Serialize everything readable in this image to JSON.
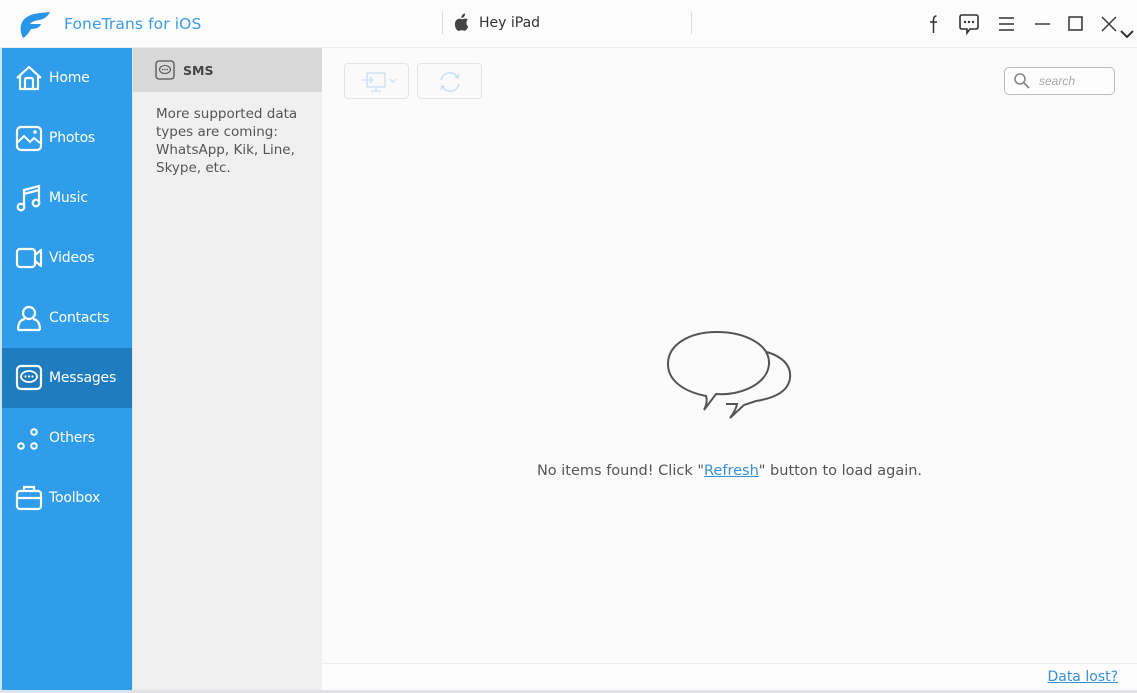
{
  "app": {
    "title": "FoneTrans for iOS",
    "brand_color": "#2f9de9",
    "active_color": "#1f7cbf"
  },
  "device": {
    "name": "Hey iPad",
    "icon": "apple-icon"
  },
  "titlebar_icons": [
    {
      "name": "facebook-icon",
      "label": "Facebook"
    },
    {
      "name": "feedback-icon",
      "label": "Feedback"
    },
    {
      "name": "menu-icon",
      "label": "Menu"
    },
    {
      "name": "minimize-icon",
      "label": "Minimize"
    },
    {
      "name": "maximize-icon",
      "label": "Maximize"
    },
    {
      "name": "close-icon",
      "label": "Close"
    }
  ],
  "sidebar": {
    "items": [
      {
        "label": "Home",
        "icon": "home-icon",
        "active": false
      },
      {
        "label": "Photos",
        "icon": "photos-icon",
        "active": false
      },
      {
        "label": "Music",
        "icon": "music-icon",
        "active": false
      },
      {
        "label": "Videos",
        "icon": "videos-icon",
        "active": false
      },
      {
        "label": "Contacts",
        "icon": "contacts-icon",
        "active": false
      },
      {
        "label": "Messages",
        "icon": "messages-icon",
        "active": true
      },
      {
        "label": "Others",
        "icon": "others-icon",
        "active": false
      },
      {
        "label": "Toolbox",
        "icon": "toolbox-icon",
        "active": false
      }
    ]
  },
  "subpanel": {
    "header_label": "SMS",
    "note": "More supported data types are coming: WhatsApp, Kik, Line, Skype, etc."
  },
  "toolbar": {
    "export_button": "export-to-pc",
    "refresh_button": "refresh"
  },
  "search": {
    "placeholder": "search",
    "value": ""
  },
  "empty_state": {
    "prefix": "No items found! Click \"",
    "link": "Refresh",
    "suffix": "\" button to load again."
  },
  "footer": {
    "data_lost_link": "Data lost?"
  }
}
